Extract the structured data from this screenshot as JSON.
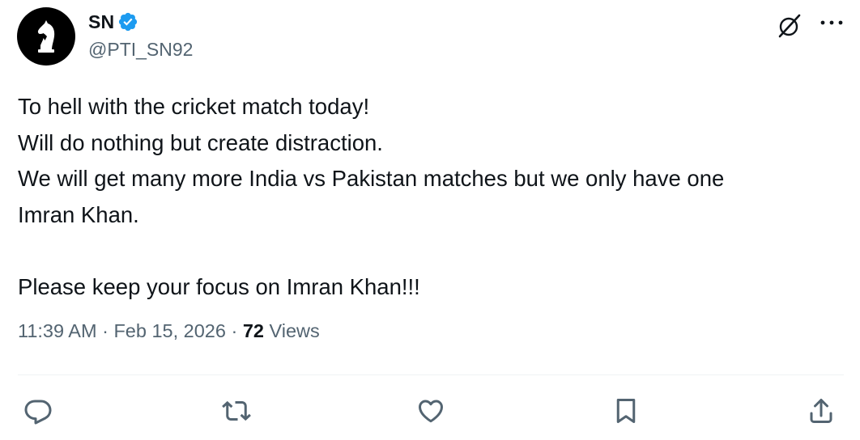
{
  "author": {
    "display_name": "SN",
    "handle": "@PTI_SN92",
    "verified": true,
    "verified_color": "#1d9bf0"
  },
  "tweet": {
    "lines": [
      "To hell with the cricket match today!",
      "Will do nothing but create distraction.",
      "We will get many more India vs Pakistan matches but we only have one",
      "Imran Khan.",
      "",
      "Please keep your focus on Imran Khan!!!"
    ]
  },
  "meta": {
    "time": "11:39 AM",
    "separator": "·",
    "date": "Feb 15, 2026",
    "views_count": "72",
    "views_label": "Views"
  },
  "icons": {
    "avatar": "chess-knight-icon",
    "header_action": "grok-icon",
    "more": "more-icon",
    "actions": [
      "reply-icon",
      "retweet-icon",
      "like-icon",
      "bookmark-icon",
      "share-icon"
    ]
  },
  "colors": {
    "text_primary": "#0f1419",
    "text_secondary": "#536471",
    "divider": "#eff3f4",
    "avatar_bg": "#000000"
  }
}
